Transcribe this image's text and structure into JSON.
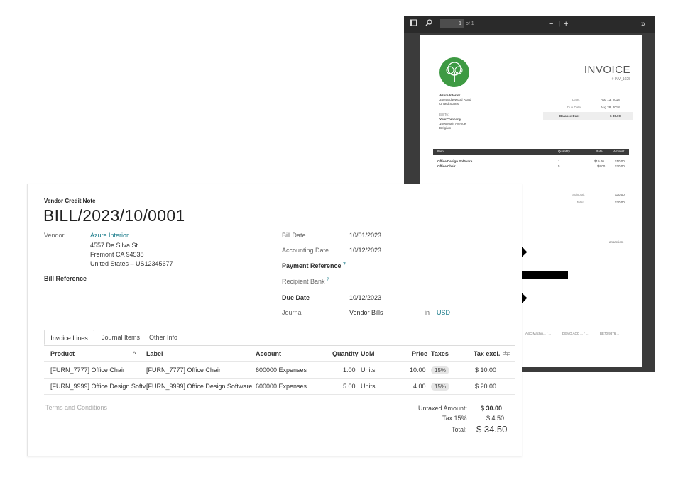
{
  "pdf_viewer": {
    "page_current": "1",
    "page_total": "of 1",
    "zoom_out": "−",
    "zoom_in": "+",
    "more": "»",
    "invoice": {
      "title": "INVOICE",
      "number": "# INV_1025",
      "company_lines": [
        "Azure Interior",
        "3404 Edgewood Road",
        "United States"
      ],
      "bill_to_label": "Bill To:",
      "bill_to_lines": [
        "YourCompany",
        "1696 Main Avenue",
        "Belgium"
      ],
      "date_label": "Date:",
      "date_value": "Aug 13, 2018",
      "due_label": "Due Date:",
      "due_value": "Aug 28, 2018",
      "balance_label": "Balance Due:",
      "balance_value": "$ 30.00",
      "table_headers": [
        "Item",
        "Quantity",
        "Rate",
        "Amount"
      ],
      "rows": [
        {
          "item": "Office Design Software",
          "qty": "1",
          "rate": "$10.00",
          "amount": "$10.00"
        },
        {
          "item": "Office Chair",
          "qty": "5",
          "rate": "$4.00",
          "amount": "$20.00"
        }
      ],
      "subtotal_label": "Subtotal:",
      "subtotal_value": "$30.00",
      "total_label": "Total:",
      "total_value": "$30.00",
      "terms_fragment": "ansaction.",
      "footer": [
        "ABC Machin... / ...",
        "DEMO ACC ... / ...",
        "BE70 9876 ..."
      ]
    }
  },
  "form": {
    "doc_type": "Vendor Credit Note",
    "doc_name": "BILL/2023/10/0001",
    "vendor_label": "Vendor",
    "vendor_name": "Azure Interior",
    "vendor_address": [
      "4557 De Silva St",
      "Fremont CA 94538",
      "United States – US12345677"
    ],
    "bill_reference_label": "Bill Reference",
    "bill_date_label": "Bill Date",
    "bill_date": "10/01/2023",
    "accounting_date_label": "Accounting Date",
    "accounting_date": "10/12/2023",
    "payment_reference_label": "Payment Reference",
    "recipient_bank_label": "Recipient Bank",
    "help_mark": "?",
    "due_date_label": "Due Date",
    "due_date": "10/12/2023",
    "journal_label": "Journal",
    "journal_value": "Vendor Bills",
    "in_label": "in",
    "currency": "USD",
    "tabs": [
      "Invoice Lines",
      "Journal Items",
      "Other Info"
    ],
    "columns": {
      "product": "Product",
      "label": "Label",
      "account": "Account",
      "quantity": "Quantity",
      "uom": "UoM",
      "price": "Price",
      "taxes": "Taxes",
      "tax_excl": "Tax excl."
    },
    "lines": [
      {
        "product": "[FURN_7777] Office Chair",
        "label": "[FURN_7777] Office Chair",
        "account": "600000 Expenses",
        "quantity": "1.00",
        "uom": "Units",
        "price": "10.00",
        "tax": "15%",
        "subtotal": "$ 10.00"
      },
      {
        "product": "[FURN_9999] Office Design Softv",
        "label": "[FURN_9999] Office Design Software",
        "account": "600000 Expenses",
        "quantity": "5.00",
        "uom": "Units",
        "price": "4.00",
        "tax": "15%",
        "subtotal": "$ 20.00"
      }
    ],
    "terms_placeholder": "Terms and Conditions",
    "untaxed_label": "Untaxed Amount:",
    "untaxed_value": "$ 30.00",
    "tax_label": "Tax 15%:",
    "tax_value": "$ 4.50",
    "total_label": "Total:",
    "total_value": "$ 34.50"
  }
}
